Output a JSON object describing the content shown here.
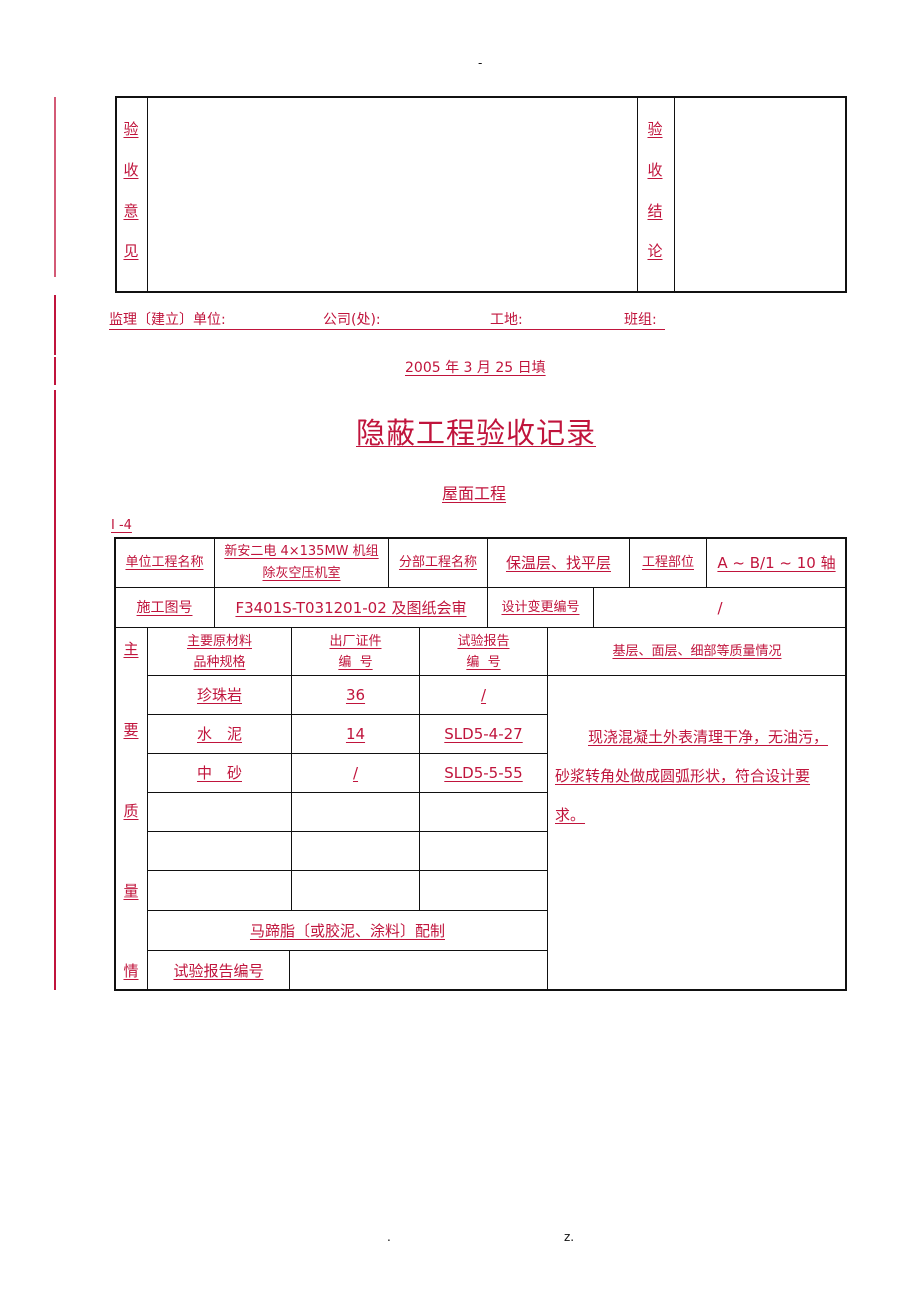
{
  "page_marks": {
    "top": "-",
    "bottom_left": ".",
    "bottom_right": "z."
  },
  "acceptance_box": {
    "opinion_label": [
      "验",
      "收",
      "意",
      "见"
    ],
    "opinion_value": "",
    "conclusion_label": [
      "验",
      "收",
      "结",
      "论"
    ],
    "conclusion_value": ""
  },
  "signature_line": {
    "supervisor_unit": "监理〔建立〕单位:",
    "company": "公司(处):",
    "site": "工地:",
    "team": "班组:"
  },
  "fill_date": "2005 年 3 月 25 日填",
  "title": "隐蔽工程验收记录",
  "subtitle": "屋面工程",
  "form_code": "I -4",
  "record_table": {
    "unit_project_label": "单位工程名称",
    "unit_project_value_line1": "新安二电 4×135MW 机组",
    "unit_project_value_line2": "除灰空压机室",
    "sub_project_label": "分部工程名称",
    "sub_project_value": "保温层、找平层",
    "project_part_label": "工程部位",
    "project_part_value": "A ~ B/1 ~ 10 轴",
    "drawing_no_label": "施工图号",
    "drawing_no_value": "F3401S-T031201-02 及图纸会审",
    "design_change_label": "设计变更编号",
    "design_change_value": "/",
    "side_label": [
      "主",
      "要",
      "质",
      "量",
      "情"
    ],
    "headers": {
      "material_line1": "主要原材料",
      "material_line2": "品种规格",
      "certificate_line1": "出厂证件",
      "certificate_line2": "编  号",
      "test_report_line1": "试验报告",
      "test_report_line2": "编  号",
      "quality": "基层、面层、细部等质量情况"
    },
    "materials": [
      {
        "name": "珍珠岩",
        "certificate_no": "36",
        "test_report_no": "/"
      },
      {
        "name": "水　泥",
        "certificate_no": "14",
        "test_report_no": "SLD5-4-27"
      },
      {
        "name": "中　砂",
        "certificate_no": "/",
        "test_report_no": "SLD5-5-55"
      },
      {
        "name": "",
        "certificate_no": "",
        "test_report_no": ""
      },
      {
        "name": "",
        "certificate_no": "",
        "test_report_no": ""
      },
      {
        "name": "",
        "certificate_no": "",
        "test_report_no": ""
      }
    ],
    "quality_description_line1": "现浇混凝土外表清理干净，无油污，",
    "quality_description_line2": "砂浆转角处做成圆弧形状，符合设计要",
    "quality_description_line3": "求。",
    "mastic_label": "马蹄脂〔或胶泥、涂料〕配制",
    "mastic_report_label": "试验报告编号",
    "mastic_report_value": ""
  }
}
